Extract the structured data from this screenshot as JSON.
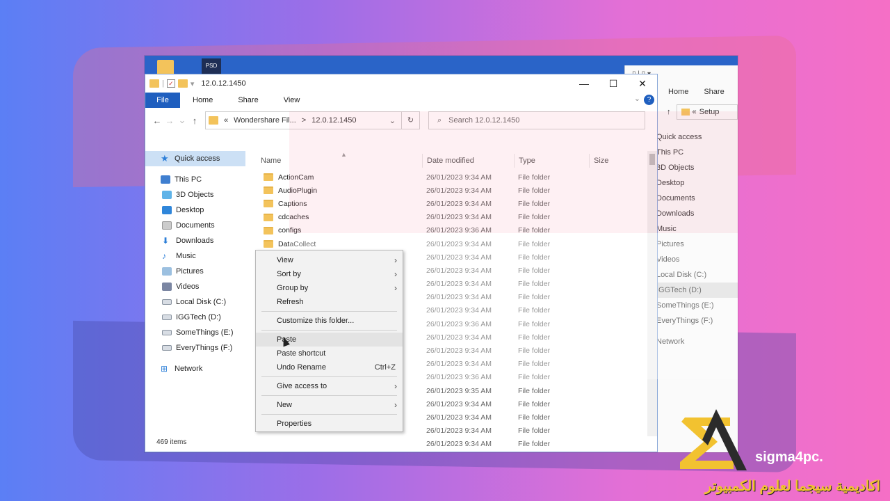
{
  "window": {
    "title": "12.0.12.1450",
    "controls": {
      "minimize": "—",
      "maximize": "☐",
      "close": "✕"
    }
  },
  "ribbon": {
    "file": "File",
    "home": "Home",
    "share": "Share",
    "view": "View",
    "help": "?"
  },
  "address": {
    "prefix": "«",
    "path1": "Wondershare Fil...",
    "sep": ">",
    "path2": "12.0.12.1450",
    "search_placeholder": "Search 12.0.12.1450"
  },
  "sidebar": [
    {
      "label": "Quick access",
      "icon": "star-icon"
    },
    {
      "label": "This PC",
      "icon": "pc-icon"
    },
    {
      "label": "3D Objects",
      "icon": "cube-icon"
    },
    {
      "label": "Desktop",
      "icon": "desktop-icon"
    },
    {
      "label": "Documents",
      "icon": "documents-icon"
    },
    {
      "label": "Downloads",
      "icon": "downloads-icon"
    },
    {
      "label": "Music",
      "icon": "music-icon"
    },
    {
      "label": "Pictures",
      "icon": "pictures-icon"
    },
    {
      "label": "Videos",
      "icon": "videos-icon"
    },
    {
      "label": "Local Disk (C:)",
      "icon": "drive-icon"
    },
    {
      "label": "IGGTech (D:)",
      "icon": "drive-icon"
    },
    {
      "label": "SomeThings (E:)",
      "icon": "drive-icon"
    },
    {
      "label": "EveryThings (F:)",
      "icon": "drive-icon"
    },
    {
      "label": "Network",
      "icon": "network-icon"
    }
  ],
  "columns": {
    "name": "Name",
    "date": "Date modified",
    "type": "Type",
    "size": "Size"
  },
  "rows": [
    {
      "name": "ActionCam",
      "date": "26/01/2023 9:34 AM",
      "type": "File folder"
    },
    {
      "name": "AudioPlugin",
      "date": "26/01/2023 9:34 AM",
      "type": "File folder"
    },
    {
      "name": "Captions",
      "date": "26/01/2023 9:34 AM",
      "type": "File folder"
    },
    {
      "name": "cdcaches",
      "date": "26/01/2023 9:34 AM",
      "type": "File folder"
    },
    {
      "name": "configs",
      "date": "26/01/2023 9:36 AM",
      "type": "File folder"
    },
    {
      "name": "DataCollect",
      "date": "26/01/2023 9:34 AM",
      "type": "File folder"
    },
    {
      "name": "DecPlugins",
      "date": "26/01/2023 9:34 AM",
      "type": "File folder"
    },
    {
      "name": "",
      "date": "26/01/2023 9:34 AM",
      "type": "File folder"
    },
    {
      "name": "",
      "date": "26/01/2023 9:34 AM",
      "type": "File folder"
    },
    {
      "name": "",
      "date": "26/01/2023 9:34 AM",
      "type": "File folder"
    },
    {
      "name": "",
      "date": "26/01/2023 9:34 AM",
      "type": "File folder"
    },
    {
      "name": "",
      "date": "26/01/2023 9:36 AM",
      "type": "File folder"
    },
    {
      "name": "",
      "date": "26/01/2023 9:34 AM",
      "type": "File folder"
    },
    {
      "name": "",
      "date": "26/01/2023 9:34 AM",
      "type": "File folder"
    },
    {
      "name": "",
      "date": "26/01/2023 9:34 AM",
      "type": "File folder"
    },
    {
      "name": "",
      "date": "26/01/2023 9:36 AM",
      "type": "File folder"
    },
    {
      "name": "",
      "date": "26/01/2023 9:35 AM",
      "type": "File folder"
    },
    {
      "name": "",
      "date": "26/01/2023 9:34 AM",
      "type": "File folder"
    },
    {
      "name": "",
      "date": "26/01/2023 9:34 AM",
      "type": "File folder"
    },
    {
      "name": "",
      "date": "26/01/2023 9:34 AM",
      "type": "File folder"
    },
    {
      "name": "",
      "date": "26/01/2023 9:34 AM",
      "type": "File folder"
    }
  ],
  "status": {
    "items": "469 items"
  },
  "context_menu": {
    "view": "View",
    "sort_by": "Sort by",
    "group_by": "Group by",
    "refresh": "Refresh",
    "customize": "Customize this folder...",
    "paste": "Paste",
    "paste_shortcut": "Paste shortcut",
    "undo_rename": "Undo Rename",
    "undo_shortcut": "Ctrl+Z",
    "give_access": "Give access to",
    "new": "New",
    "properties": "Properties"
  },
  "back_window": {
    "home": "Home",
    "share": "Share",
    "addr": "Setup",
    "nav": [
      "Quick access",
      "This PC",
      "3D Objects",
      "Desktop",
      "Documents",
      "Downloads",
      "Music",
      "Pictures",
      "Videos",
      "Local Disk (C:)",
      "IGGTech (D:)",
      "SomeThings (E:)",
      "EveryThings (F:)",
      "Network"
    ]
  },
  "desktop": {
    "psd_label": "PSD"
  },
  "brand": {
    "name": "sigma4pc.",
    "arabic": "اكاديمية سيجما لعلوم الكمبيوتر"
  }
}
